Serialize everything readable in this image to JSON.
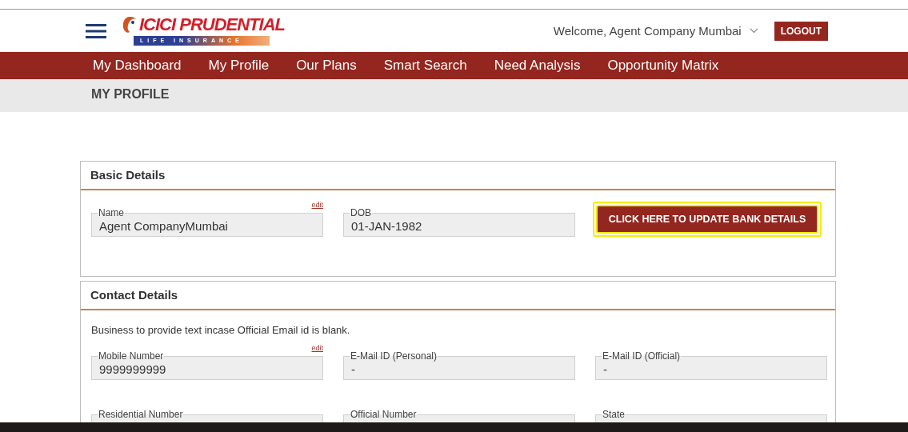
{
  "header": {
    "logo": {
      "brand": "ICICI PRUDENTIAL",
      "tagline": "LIFE INSURANCE"
    },
    "welcome": "Welcome, Agent Company Mumbai",
    "logout": "LOGOUT"
  },
  "nav": [
    {
      "label": "My Dashboard"
    },
    {
      "label": "My Profile"
    },
    {
      "label": "Our Plans"
    },
    {
      "label": "Smart Search"
    },
    {
      "label": "Need Analysis"
    },
    {
      "label": "Opportunity Matrix"
    }
  ],
  "page_title": "MY PROFILE",
  "sections": [
    {
      "title": "Basic Details",
      "fields": [
        {
          "label": "Name",
          "value": "Agent CompanyMumbai",
          "edit_link": "edit"
        },
        {
          "label": "DOB",
          "value": "01-JAN-1982"
        }
      ],
      "action": {
        "label": "CLICK HERE TO UPDATE BANK DETAILS",
        "highlighted": true
      }
    },
    {
      "title": "Contact Details",
      "note": "Business to provide text incase Official Email id is blank.",
      "fields": [
        {
          "label": "Mobile Number",
          "value": "9999999999",
          "edit_link": "edit"
        },
        {
          "label": "E-Mail ID (Personal)",
          "value": "-"
        },
        {
          "label": "E-Mail ID (Official)",
          "value": "-"
        },
        {
          "label": "Residential Number"
        },
        {
          "label": "Official Number"
        },
        {
          "label": "State"
        }
      ]
    }
  ]
}
